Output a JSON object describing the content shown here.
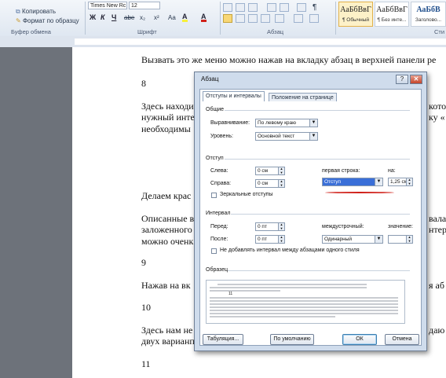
{
  "ribbon": {
    "clipboard": {
      "copy": "Копировать",
      "format_painter": "Формат по образцу",
      "group": "Буфер обмена"
    },
    "font": {
      "name": "Times New Rc",
      "size": "12",
      "group": "Шрифт",
      "bold": "Ж",
      "italic": "К",
      "underline": "Ч",
      "strike": "abe",
      "sub": "x₂",
      "sup": "x²",
      "clear": "Aa",
      "highlight": "A",
      "color": "A"
    },
    "paragraph": {
      "group": "Абзац",
      "show_marks": "¶"
    },
    "styles": [
      {
        "sample": "АаБбВвГ",
        "name": "¶ Обычный"
      },
      {
        "sample": "АаБбВвГ",
        "name": "¶ Без инте..."
      },
      {
        "sample": "АаБбВ",
        "name": "Заголово..."
      }
    ],
    "styles_group": "Сти"
  },
  "document": {
    "lines": [
      "Вызвать это же меню можно нажав на вкладку абзац в верхней панели ре",
      "8",
      "Здесь находи",
      "нужный инте",
      "необходимы",
      "Делаем крас",
      "Описанные в",
      "заложенного",
      "можно оченк",
      "9",
      "Нажав на вк",
      "10",
      "Здесь нам не",
      "двух варианп",
      "11"
    ],
    "right_fragments": [
      "кото",
      "ку «",
      "вала",
      "нтер",
      "я аб",
      "даю"
    ]
  },
  "dialog": {
    "title": "Абзац",
    "help": "?",
    "close": "✕",
    "tabs": [
      "Отступы и интервалы",
      "Положение на странице"
    ],
    "general": {
      "heading": "Общие",
      "alignment_label": "Выравнивание:",
      "alignment_value": "По левому краю",
      "level_label": "Уровень:",
      "level_value": "Основной текст"
    },
    "indent": {
      "heading": "Отступ",
      "left_label": "Слева:",
      "left_value": "0 см",
      "right_label": "Справа:",
      "right_value": "0 см",
      "first_line_label": "первая строка:",
      "first_line_value": "Отступ",
      "on_label": "на:",
      "on_value": "1,25 см",
      "mirror_label": "Зеркальные отступы"
    },
    "spacing": {
      "heading": "Интервал",
      "before_label": "Перед:",
      "before_value": "0 пт",
      "after_label": "После:",
      "after_value": "0 пт",
      "line_label": "междустрочный:",
      "line_value": "Одинарный",
      "value_label": "значение:",
      "value_value": "",
      "no_space_label": "Не добавлять интервал между абзацами одного стиля"
    },
    "sample": {
      "heading": "Образец",
      "number": "11"
    },
    "buttons": {
      "tabs": "Табуляция...",
      "default": "По умолчанию",
      "ok": "ОК",
      "cancel": "Отмена"
    }
  },
  "colors": {
    "selection": "#3a6fd8",
    "annotation": "#d0211a"
  }
}
